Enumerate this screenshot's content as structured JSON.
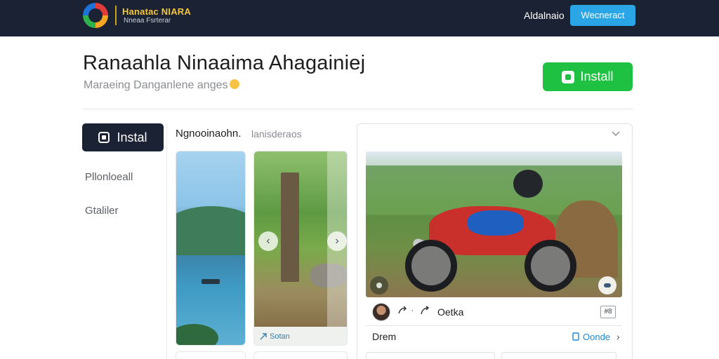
{
  "topbar": {
    "brand_name": "Hanatac NIARA",
    "brand_sub": "Nneaa Fsrterar",
    "nav_link": "Aldalnaio",
    "nav_button": "Wecneract"
  },
  "header": {
    "title": "Ranaahla Ninaaima  Ahagainiej",
    "subtitle": "Maraeing Danganlene anges",
    "install_label": "Install"
  },
  "sidebar": {
    "install_label": "Instal",
    "items": [
      {
        "label": "Pllonloeall"
      },
      {
        "label": "Gtaliler"
      }
    ]
  },
  "gallery": {
    "title": "Ngnooinaohn.",
    "subtitle": "lanisderaos",
    "thumb_caption": "Sotan",
    "caption_icon": "link-icon"
  },
  "card": {
    "username": "Oetka",
    "badge": "#8",
    "label": "Drem",
    "link_label": "Oonde"
  },
  "colors": {
    "topbar_bg": "#1b2233",
    "brand_accent": "#f2c640",
    "nav_button": "#2aa6e6",
    "install_green": "#1ec141",
    "sidebar_active": "#1b2233",
    "link_blue": "#1d8ad6"
  }
}
